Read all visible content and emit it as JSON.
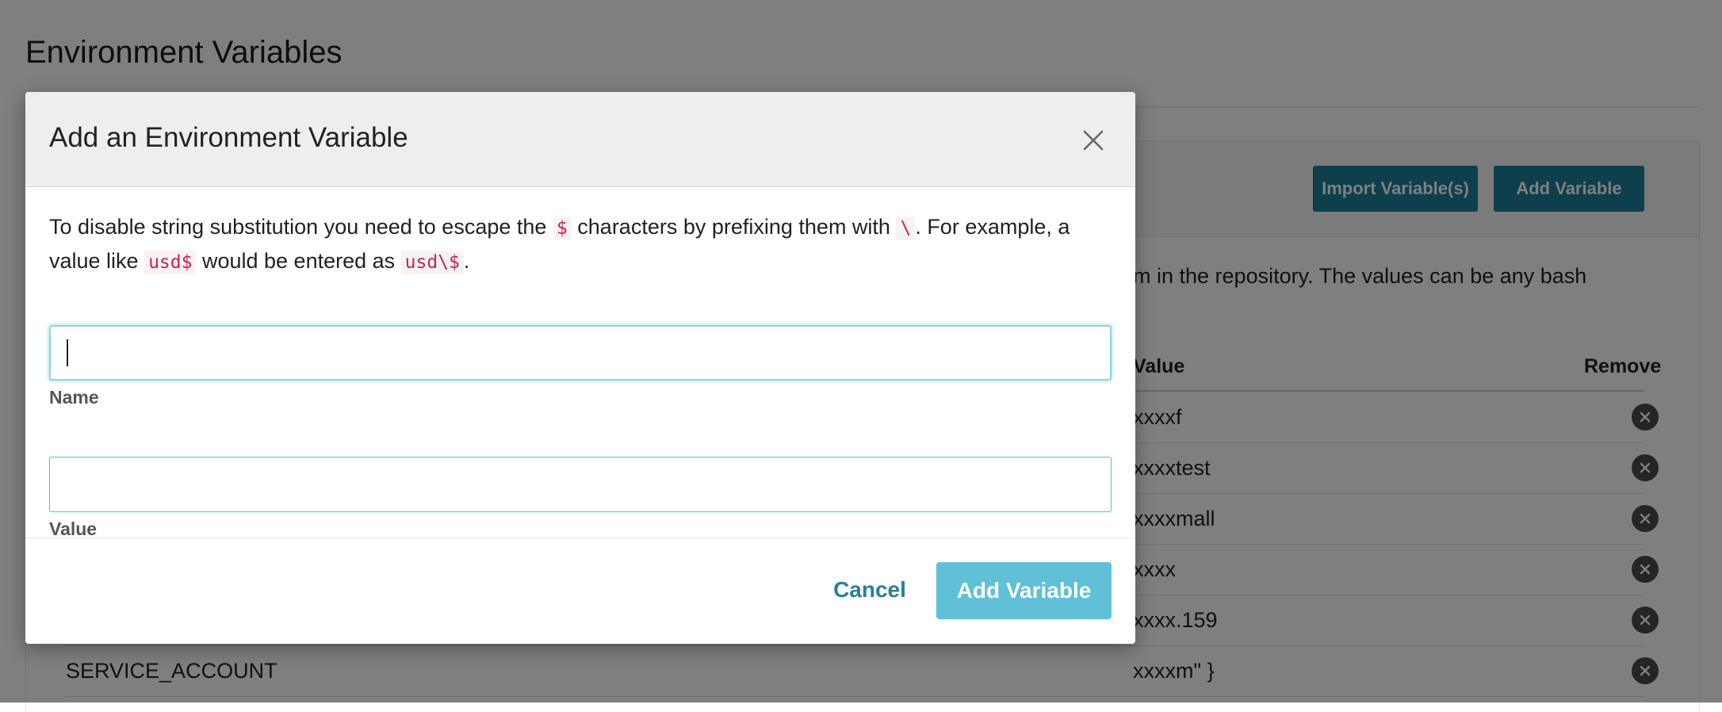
{
  "page": {
    "title": "Environment Variables",
    "import_button": "Import Variable(s)",
    "add_button": "Add Variable",
    "description": "m in the repository. The values can be any bash",
    "table": {
      "headers": {
        "name": "",
        "value": "Value",
        "remove": "Remove"
      },
      "rows": [
        {
          "name": "",
          "value": "xxxxf"
        },
        {
          "name": "",
          "value": "xxxxtest"
        },
        {
          "name": "",
          "value": "xxxxmall"
        },
        {
          "name": "",
          "value": "xxxx"
        },
        {
          "name": "",
          "value": "xxxx.159"
        },
        {
          "name": "SERVICE_ACCOUNT",
          "value": "xxxxm\" }"
        }
      ]
    }
  },
  "modal": {
    "title": "Add an Environment Variable",
    "hint": {
      "part1": "To disable string substitution you need to escape the ",
      "code1": "$",
      "part2": " characters by prefixing them with ",
      "code2": "\\",
      "part3": ". For example, a value like ",
      "code3": "usd$",
      "part4": " would be entered as ",
      "code4": "usd\\$",
      "part5": "."
    },
    "name_label": "Name",
    "name_value": "",
    "value_label": "Value",
    "value_value": "",
    "cancel_button": "Cancel",
    "submit_button": "Add Variable"
  },
  "icons": {
    "close": "close-icon",
    "remove": "remove-circle-icon"
  },
  "colors": {
    "primary_teal": "#1b7f99",
    "submit_button": "#5fc0d8",
    "input_focus": "#6cc4d6",
    "code_text": "#c7254e"
  }
}
